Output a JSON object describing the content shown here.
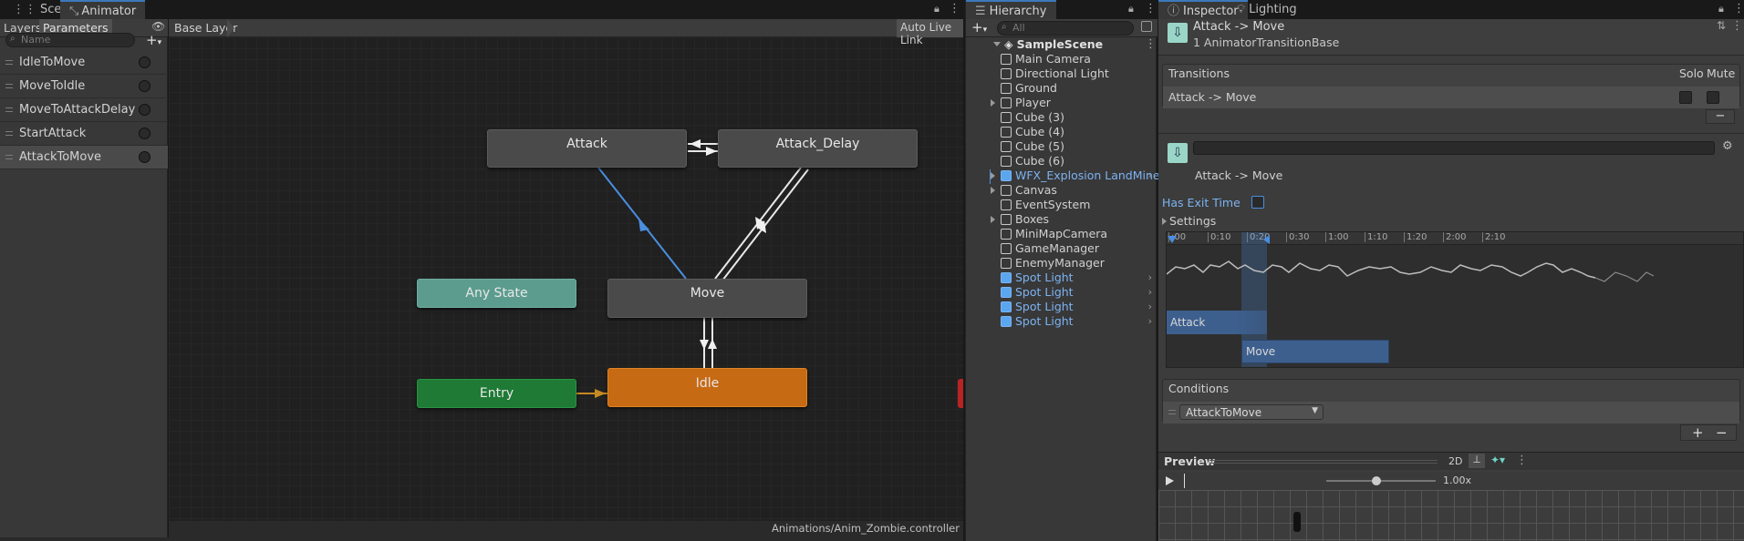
{
  "animator": {
    "tabs": {
      "scene": "Scene",
      "animator": "Animator"
    },
    "subtabs": {
      "layers": "Layers",
      "parameters": "Parameters"
    },
    "search_placeholder": "Name",
    "parameters": [
      {
        "name": "IdleToMove"
      },
      {
        "name": "MoveToIdle"
      },
      {
        "name": "MoveToAttackDelay"
      },
      {
        "name": "StartAttack"
      },
      {
        "name": "AttackToMove"
      }
    ],
    "breadcrumb": "Base Layer",
    "auto_live_link": "Auto Live Link",
    "states": {
      "attack": "Attack",
      "attack_delay": "Attack_Delay",
      "any_state": "Any State",
      "move": "Move",
      "entry": "Entry",
      "idle": "Idle"
    },
    "footer_path": "Animations/Anim_Zombie.controller",
    "colors": {
      "default_state": "#4a4a4a",
      "any_state": "#5b9c8e",
      "entry": "#1e7a34",
      "idle": "#c66a14",
      "selected_transition": "#4a8ee0"
    }
  },
  "hierarchy": {
    "title": "Hierarchy",
    "search_placeholder": "All",
    "scene_name": "SampleScene",
    "items": [
      {
        "label": "Main Camera",
        "type": "object",
        "expandable": false
      },
      {
        "label": "Directional Light",
        "type": "object",
        "expandable": false
      },
      {
        "label": "Ground",
        "type": "object",
        "expandable": false
      },
      {
        "label": "Player",
        "type": "object",
        "expandable": true
      },
      {
        "label": "Cube (3)",
        "type": "object",
        "expandable": false
      },
      {
        "label": "Cube (4)",
        "type": "object",
        "expandable": false
      },
      {
        "label": "Cube (5)",
        "type": "object",
        "expandable": false
      },
      {
        "label": "Cube (6)",
        "type": "object",
        "expandable": false
      },
      {
        "label": "WFX_Explosion LandMine",
        "type": "prefab",
        "expandable": true
      },
      {
        "label": "Canvas",
        "type": "object",
        "expandable": true
      },
      {
        "label": "EventSystem",
        "type": "object",
        "expandable": false
      },
      {
        "label": "Boxes",
        "type": "object",
        "expandable": true
      },
      {
        "label": "MiniMapCamera",
        "type": "object",
        "expandable": false
      },
      {
        "label": "GameManager",
        "type": "object",
        "expandable": false
      },
      {
        "label": "EnemyManager",
        "type": "object",
        "expandable": false
      },
      {
        "label": "Spot Light",
        "type": "prefab",
        "expandable": false
      },
      {
        "label": "Spot Light",
        "type": "prefab",
        "expandable": false
      },
      {
        "label": "Spot Light",
        "type": "prefab",
        "expandable": false
      },
      {
        "label": "Spot Light",
        "type": "prefab",
        "expandable": false
      }
    ]
  },
  "inspector": {
    "tabs": {
      "inspector": "Inspector",
      "lighting": "Lighting"
    },
    "header_title": "Attack -> Move",
    "header_subtitle": "1 AnimatorTransitionBase",
    "transitions_label": "Transitions",
    "solo_label": "Solo",
    "mute_label": "Mute",
    "transition_row": "Attack -> Move",
    "transition_name": "Attack -> Move",
    "has_exit_time_label": "Has Exit Time",
    "settings_label": "Settings",
    "timeline_ticks": [
      ":00",
      "0:10",
      "0:20",
      "0:30",
      "1:00",
      "1:10",
      "1:20",
      "2:00",
      "2:10"
    ],
    "timeline_clips": {
      "attack": "Attack",
      "move": "Move"
    },
    "conditions_label": "Conditions",
    "condition_value": "AttackToMove",
    "preview_label": "Preview",
    "preview_2d": "2D",
    "preview_speed": "1.00x"
  }
}
